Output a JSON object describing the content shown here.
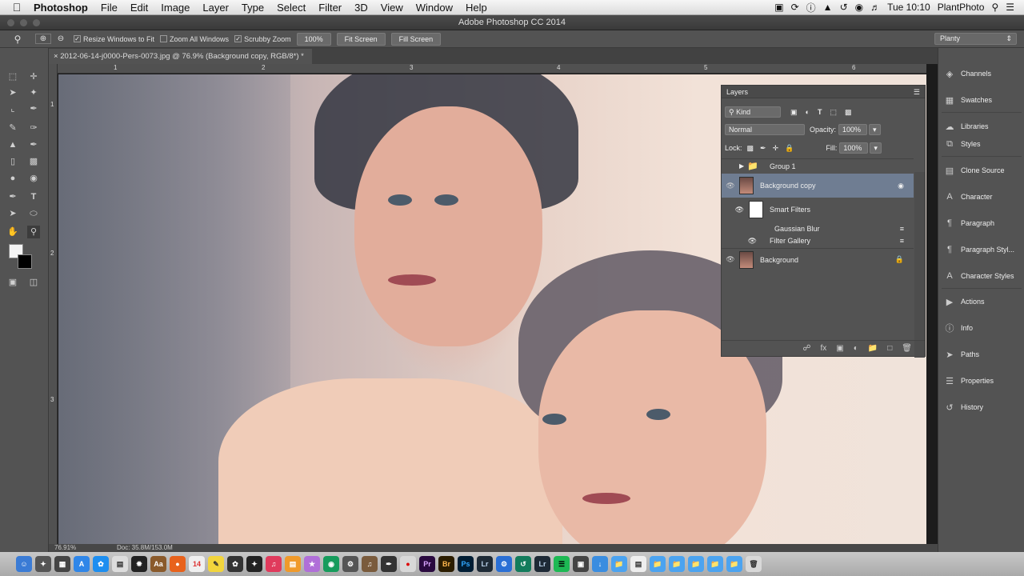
{
  "menubar": {
    "app_name": "Photoshop",
    "items": [
      "File",
      "Edit",
      "Image",
      "Layer",
      "Type",
      "Select",
      "Filter",
      "3D",
      "View",
      "Window",
      "Help"
    ],
    "clock": "Tue 10:10",
    "user": "PlantPhoto"
  },
  "window": {
    "title": "Adobe Photoshop CC 2014"
  },
  "options": {
    "resize_windows": "Resize Windows to Fit",
    "zoom_all": "Zoom All Windows",
    "scrubby_zoom": "Scrubby Zoom",
    "zoom_value": "100%",
    "fit_screen": "Fit Screen",
    "fill_screen": "Fill Screen",
    "workspace": "Planty"
  },
  "document": {
    "tab_label": "2012-06-14-j0000-Pers-0073.jpg @ 76.9% (Background copy, RGB/8*) *",
    "zoom_status": "76.91%",
    "doc_status": "Doc: 35.8M/153.0M"
  },
  "rulers": {
    "top": [
      "1",
      "2",
      "3",
      "4",
      "5",
      "6"
    ],
    "left": [
      "1",
      "2",
      "3"
    ]
  },
  "layers_panel": {
    "title": "Layers",
    "filter_kind": "Kind",
    "blend_mode": "Normal",
    "opacity_label": "Opacity:",
    "opacity_value": "100%",
    "lock_label": "Lock:",
    "fill_label": "Fill:",
    "fill_value": "100%",
    "layers": [
      {
        "name": "Group 1"
      },
      {
        "name": "Background copy"
      },
      {
        "name": "Smart Filters"
      },
      {
        "name": "Gaussian Blur"
      },
      {
        "name": "Filter Gallery"
      },
      {
        "name": "Background"
      }
    ]
  },
  "dock_panels": [
    "Channels",
    "Swatches",
    "Libraries",
    "Styles",
    "Clone Source",
    "Character",
    "Paragraph",
    "Paragraph Styl...",
    "Character Styles",
    "Actions",
    "Info",
    "Paths",
    "Properties",
    "History"
  ],
  "colors": {
    "selection": "#6f7d92",
    "panel": "#535353",
    "chrome": "#3a3a3a"
  }
}
